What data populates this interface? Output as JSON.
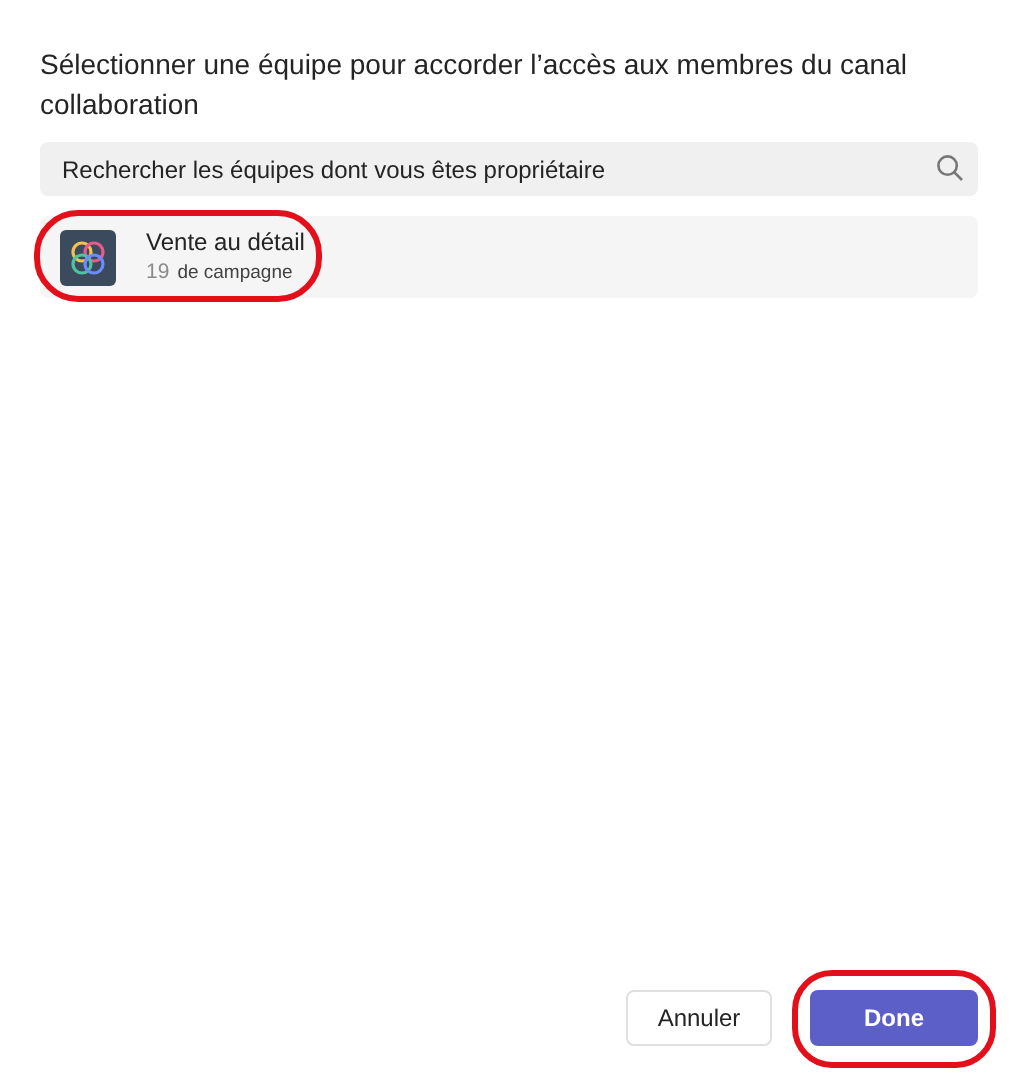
{
  "heading": "Sélectionner une équipe pour accorder l’accès aux membres du canal collaboration",
  "search": {
    "placeholder": "Rechercher les équipes dont vous êtes propriétaire"
  },
  "teams": [
    {
      "name": "Vente au détail",
      "count": "19",
      "subtitle": "de campagne",
      "highlighted": true
    }
  ],
  "buttons": [
    {
      "label": "Annuler",
      "kind": "secondary",
      "highlighted": false
    },
    {
      "label": "Done",
      "kind": "primary",
      "highlighted": true
    }
  ]
}
